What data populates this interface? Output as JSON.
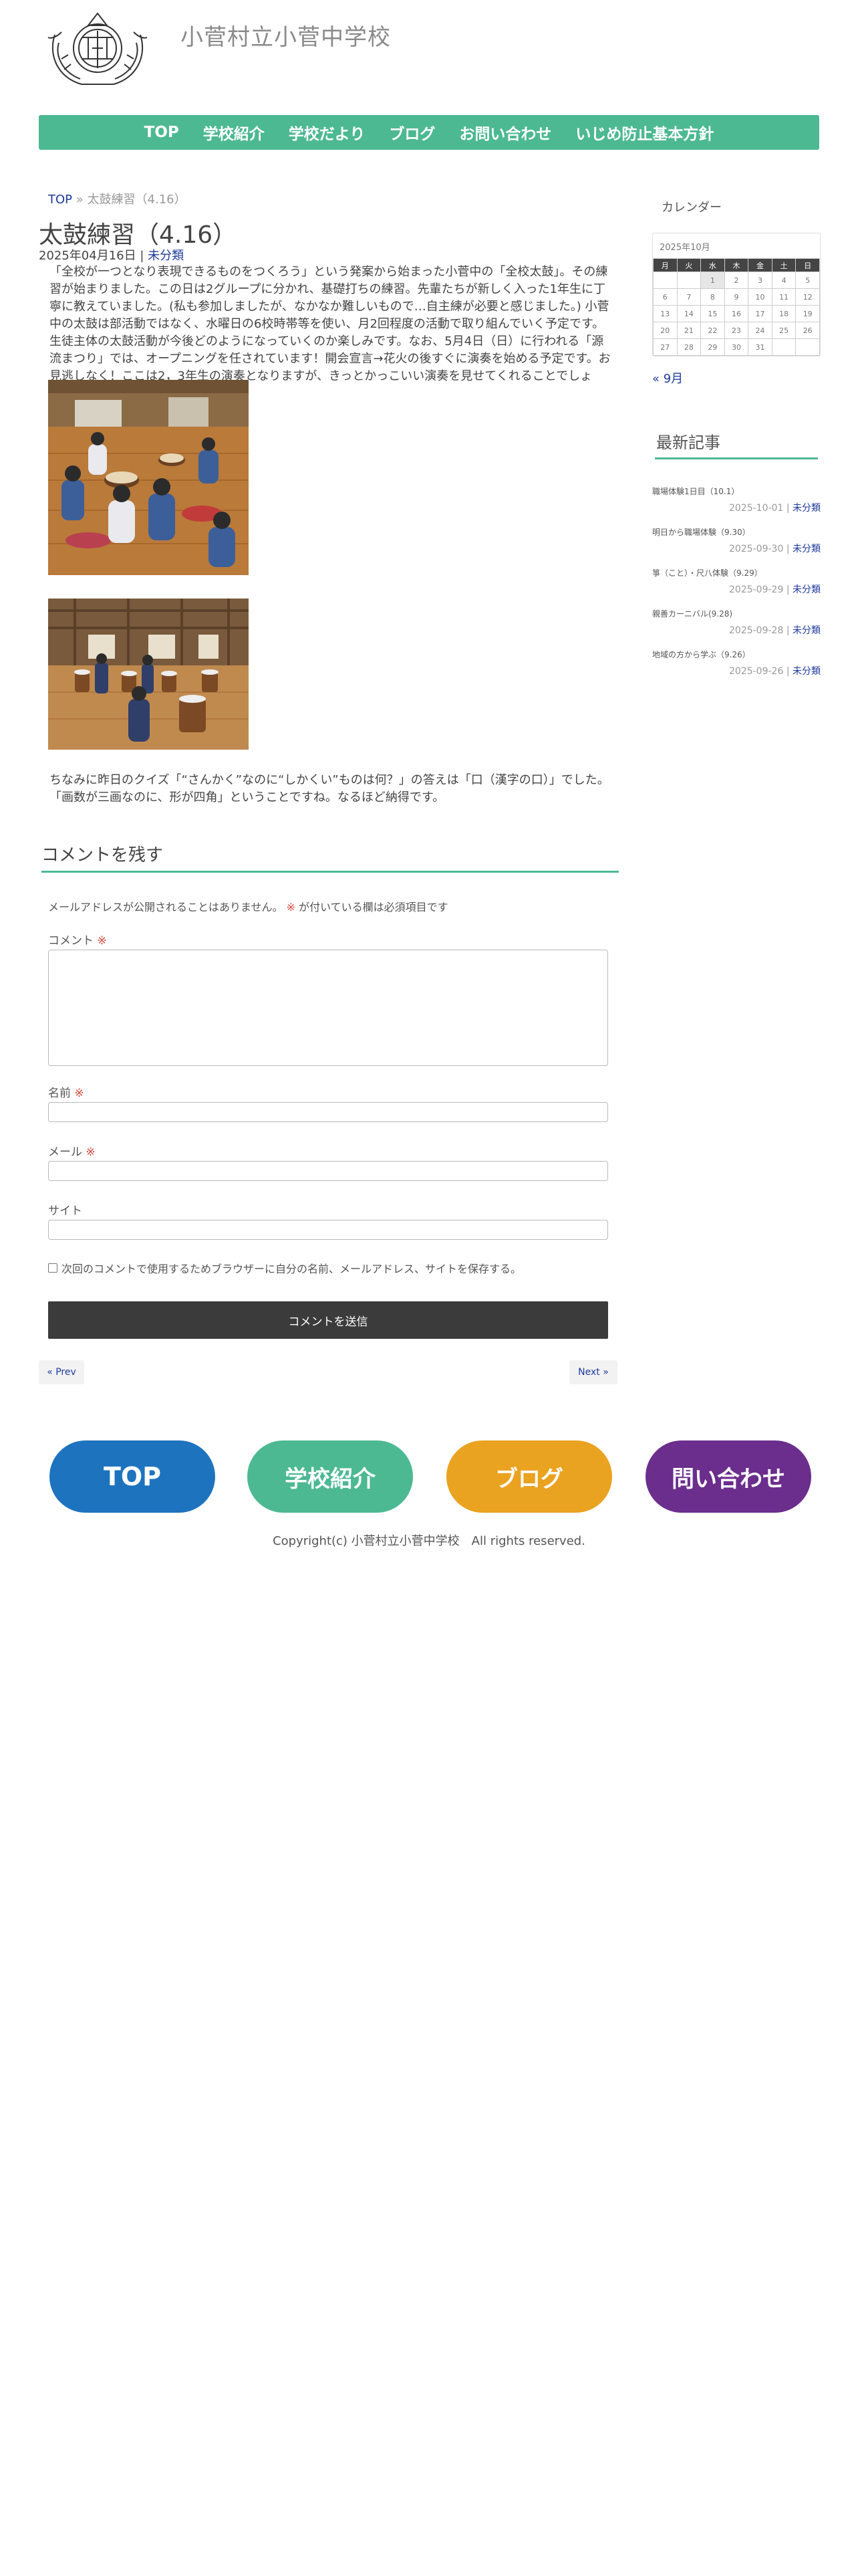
{
  "site": {
    "title": "小菅村立小菅中学校",
    "logo_icon": "school-emblem-icon"
  },
  "nav": {
    "items": [
      "TOP",
      "学校紹介",
      "学校だより",
      "ブログ",
      "お問い合わせ",
      "いじめ防止基本方針"
    ],
    "color": "#4cb993"
  },
  "breadcrumb": {
    "home": "TOP",
    "separator": "»",
    "current": "太鼓練習（4.16）"
  },
  "post": {
    "title": "太鼓練習（4.16）",
    "date": "2025年04月16日",
    "meta_separator": "|",
    "category": "未分類",
    "body": "「全校が一つとなり表現できるものをつくろう」という発案から始まった小菅中の「全校太鼓」。その練習が始まりました。この日は2グループに分かれ、基礎打ちの練習。先輩たちが新しく入った1年生に丁寧に教えていました。(私も参加しましたが、なかなか難しいもので…自主練が必要と感じました。) 小菅中の太鼓は部活動ではなく、水曜日の6校時帯等を使い、月2回程度の活動で取り組んでいく予定です。生徒主体の太鼓活動が今後どのようになっていくのか楽しみです。なお、5月4日（日）に行われる「源流まつり」では、オープニングを任されています！開会宣言→花火の後すぐに演奏を始める予定です。お見逃しなく！ここは2，3年生の演奏となりますが、きっとかっこいい演奏を見せてくれることでしょう。ぜひご期待ください！",
    "note": "ちなみに昨日のクイズ「“さんかく”なのに“しかくい”ものは何？」の答えは「口（漢字の口）」でした。「画数が三画なのに、形が四角」ということですね。なるほど納得です。"
  },
  "comment_form": {
    "heading": "コメントを残す",
    "notes": "メールアドレスが公開されることはありません。",
    "required_mark": "※",
    "required_text": "が付いている欄は必須項目です",
    "comment_label": "コメント",
    "name_label": "名前",
    "email_label": "メール",
    "url_label": "サイト",
    "cookie_label": "次回のコメントで使用するためブラウザーに自分の名前、メールアドレス、サイトを保存する。",
    "submit_label": "コメントを送信"
  },
  "pager": {
    "prev": "« Prev",
    "next": "Next »"
  },
  "sidebar": {
    "calendar": {
      "title": "カレンダー",
      "caption": "2025年10月",
      "weekdays": [
        "月",
        "火",
        "水",
        "木",
        "金",
        "土",
        "日"
      ],
      "rows": [
        [
          "",
          "",
          "1",
          "2",
          "3",
          "4",
          "5"
        ],
        [
          "6",
          "7",
          "8",
          "9",
          "10",
          "11",
          "12"
        ],
        [
          "13",
          "14",
          "15",
          "16",
          "17",
          "18",
          "19"
        ],
        [
          "20",
          "21",
          "22",
          "23",
          "24",
          "25",
          "26"
        ],
        [
          "27",
          "28",
          "29",
          "30",
          "31",
          "",
          ""
        ]
      ],
      "today": "1",
      "prev_link": "« 9月"
    },
    "recent": {
      "title": "最新記事",
      "items": [
        {
          "title": "職場体験1日目（10.1）",
          "date": "2025-10-01",
          "category": "未分類"
        },
        {
          "title": "明日から職場体験（9.30）",
          "date": "2025-09-30",
          "category": "未分類"
        },
        {
          "title": "箏（こと）・尺八体験（9.29）",
          "date": "2025-09-29",
          "category": "未分類"
        },
        {
          "title": "親善カーニバル(9.28)",
          "date": "2025-09-28",
          "category": "未分類"
        },
        {
          "title": "地域の方から学ぶ（9.26）",
          "date": "2025-09-26",
          "category": "未分類"
        }
      ]
    }
  },
  "footer": {
    "buttons": [
      {
        "label": "TOP",
        "color": "#1e73be"
      },
      {
        "label": "学校紹介",
        "color": "#4cb993"
      },
      {
        "label": "ブログ",
        "color": "#eaa320"
      },
      {
        "label": "問い合わせ",
        "color": "#6b2e8d"
      }
    ],
    "copyright": "Copyright(c) 小菅村立小菅中学校　All rights reserved."
  }
}
